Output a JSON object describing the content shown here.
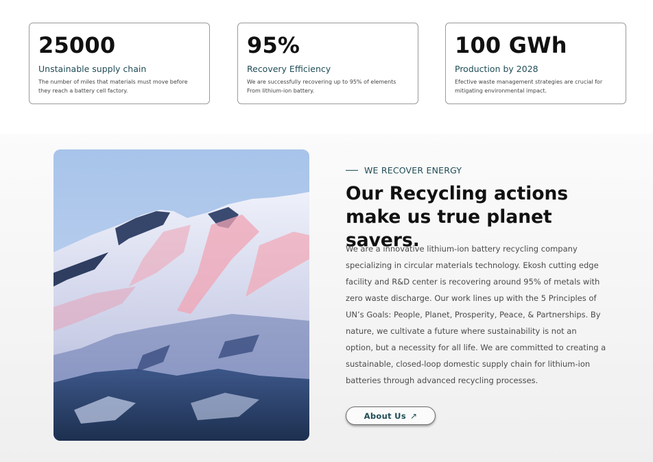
{
  "stats": [
    {
      "value": "25000",
      "title": "Unstainable supply chain",
      "description": "The number of miles that materials must move before they reach a battery cell factory."
    },
    {
      "value": "95%",
      "title": "Recovery Efficiency",
      "description": "We are successfully recovering up to 95% of elements From lithium-ion battery."
    },
    {
      "value": "100 GWh",
      "title": "Production by 2028",
      "description": "Efective waste management strategies are crucial for mitigating environmental impact."
    }
  ],
  "about": {
    "eyebrow": "WE RECOVER ENERGY",
    "headline": "Our Recycling actions make us true planet savers.",
    "body": "We are a innovative lithium-ion battery recycling company specializing in circular materials technology. Ekosh cutting edge facility and R&D center is recovering around 95% of metals with zero waste discharge. Our work lines up with the 5 Principles of UN’s Goals: People, Planet, Prosperity, Peace, & Partnerships.  By nature, we cultivate a future where sustainability is not an option, but a necessity for all life. We are committed to creating a sustainable, closed-loop domestic supply chain for lithium-ion batteries through advanced recycling processes.",
    "button_label": "About Us",
    "button_icon": "arrow-up-right-icon",
    "image": "snowy-mountain-photo"
  },
  "colors": {
    "accent": "#204d57",
    "card_border": "#9a9a9a"
  }
}
